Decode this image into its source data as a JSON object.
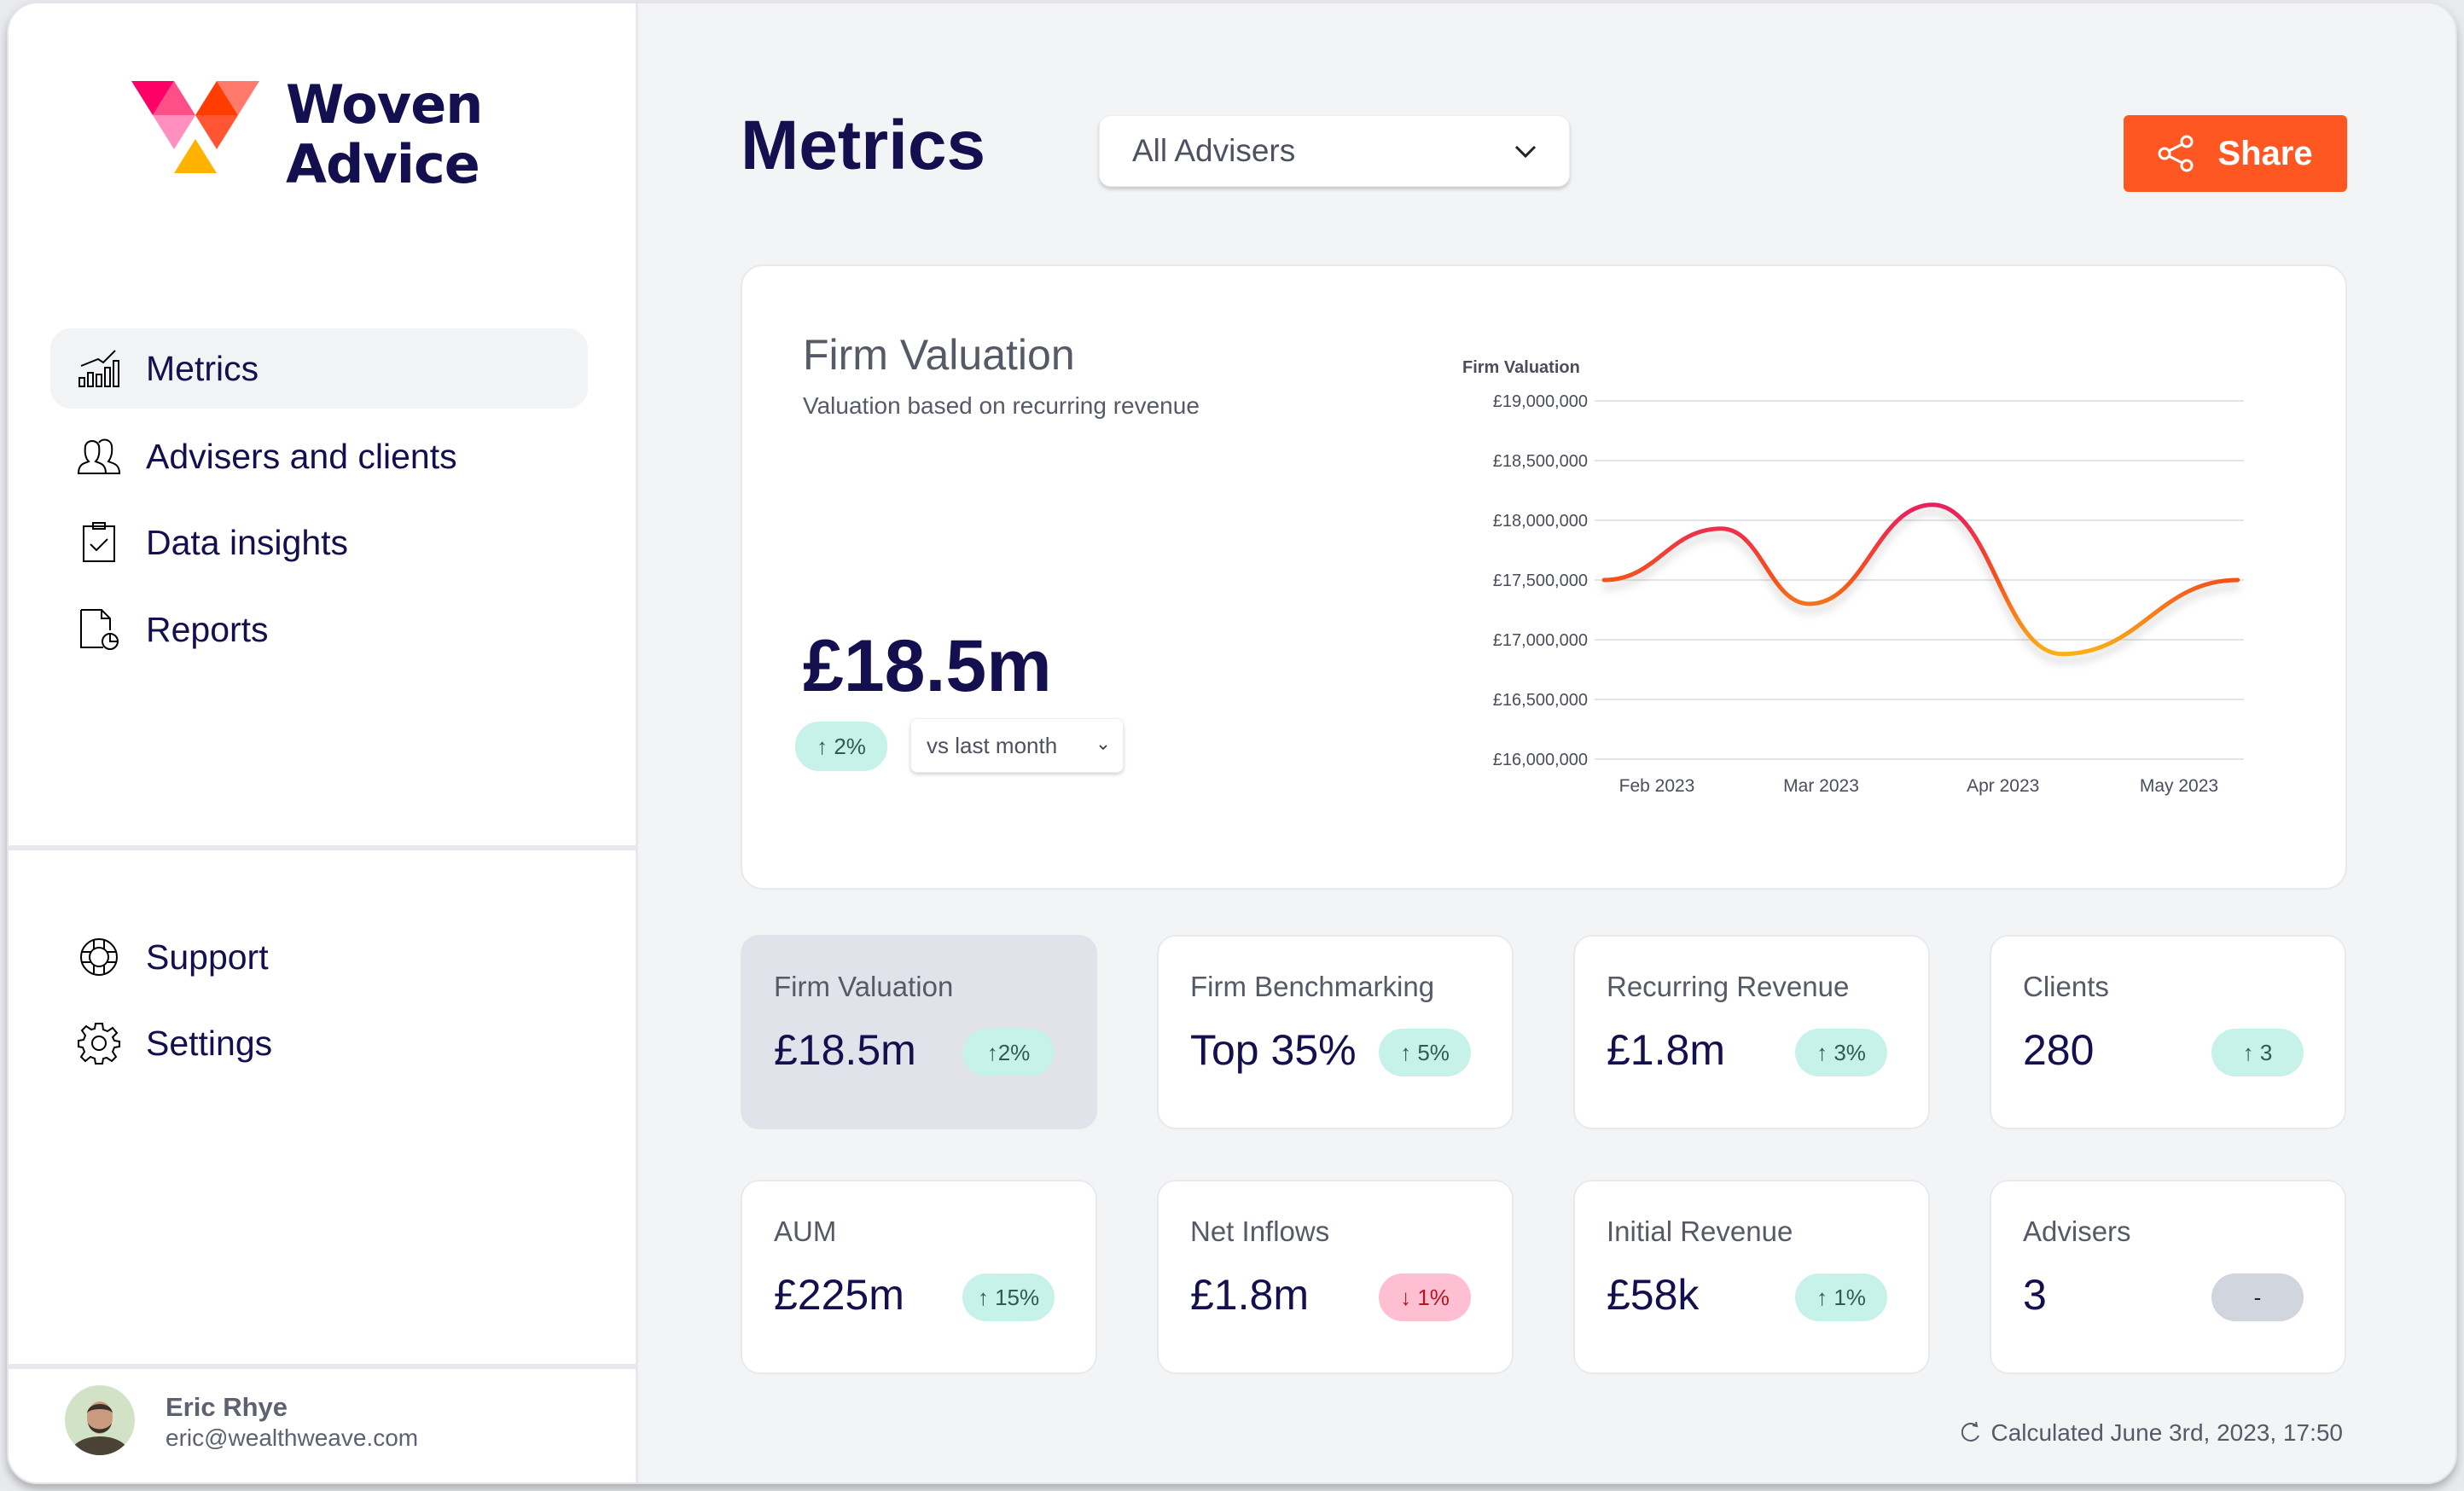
{
  "brand": {
    "name_line1": "Woven",
    "name_line2": "Advice",
    "logo_colors": [
      "#ff0066",
      "#ff4f88",
      "#ff3d00",
      "#ff7a6b",
      "#ff8fbf",
      "#ff5533",
      "#ffb300"
    ]
  },
  "sidebar": {
    "nav": [
      {
        "label": "Metrics",
        "icon": "chart-icon",
        "active": true
      },
      {
        "label": "Advisers and clients",
        "icon": "users-icon",
        "active": false
      },
      {
        "label": "Data insights",
        "icon": "clipboard-check-icon",
        "active": false
      },
      {
        "label": "Reports",
        "icon": "report-icon",
        "active": false
      }
    ],
    "secondary": [
      {
        "label": "Support",
        "icon": "lifebuoy-icon"
      },
      {
        "label": "Settings",
        "icon": "gear-icon"
      }
    ],
    "user": {
      "name": "Eric Rhye",
      "email": "eric@wealthweave.com"
    }
  },
  "header": {
    "title": "Metrics",
    "adviser_select": "All Advisers",
    "share_label": "Share",
    "accent": "#ff5722"
  },
  "valuation_card": {
    "title": "Firm Valuation",
    "subtitle": "Valuation based on recurring revenue",
    "value": "£18.5m",
    "change": "↑ 2%",
    "comparison": "vs last month"
  },
  "chart_data": {
    "type": "line",
    "title": "Firm Valuation",
    "y_ticks": [
      "£19,000,000",
      "£18,500,000",
      "£18,000,000",
      "£17,500,000",
      "£17,000,000",
      "£16,500,000",
      "£16,000,000"
    ],
    "ylim": [
      16000000,
      19000000
    ],
    "x_ticks": [
      "Feb 2023",
      "Mar 2023",
      "Apr 2023",
      "May 2023"
    ],
    "grid": true,
    "series": [
      {
        "x": [
          "2023-01-23",
          "2023-02-12",
          "2023-02-27",
          "2023-03-20",
          "2023-04-11",
          "2023-05-11"
        ],
        "values": [
          17500000,
          17930000,
          17300000,
          18130000,
          16880000,
          17500000
        ]
      }
    ],
    "colors": {
      "high": "#e91e63",
      "mid": "#f4511e",
      "low": "#fbb117"
    }
  },
  "metrics": [
    {
      "label": "Firm Valuation",
      "value": "£18.5m",
      "change": "↑2%",
      "trend": "up",
      "active": true
    },
    {
      "label": "Firm Benchmarking",
      "value": "Top 35%",
      "change": "↑ 5%",
      "trend": "up"
    },
    {
      "label": "Recurring Revenue",
      "value": "£1.8m",
      "change": "↑ 3%",
      "trend": "up"
    },
    {
      "label": "Clients",
      "value": "280",
      "change": "↑ 3",
      "trend": "up"
    },
    {
      "label": "AUM",
      "value": "£225m",
      "change": "↑ 15%",
      "trend": "up"
    },
    {
      "label": "Net Inflows",
      "value": "£1.8m",
      "change": "↓ 1%",
      "trend": "down"
    },
    {
      "label": "Initial Revenue",
      "value": "£58k",
      "change": "↑ 1%",
      "trend": "up"
    },
    {
      "label": "Advisers",
      "value": "3",
      "change": "-",
      "trend": "neutral"
    }
  ],
  "footer": {
    "calculated": "Calculated June 3rd, 2023, 17:50"
  }
}
